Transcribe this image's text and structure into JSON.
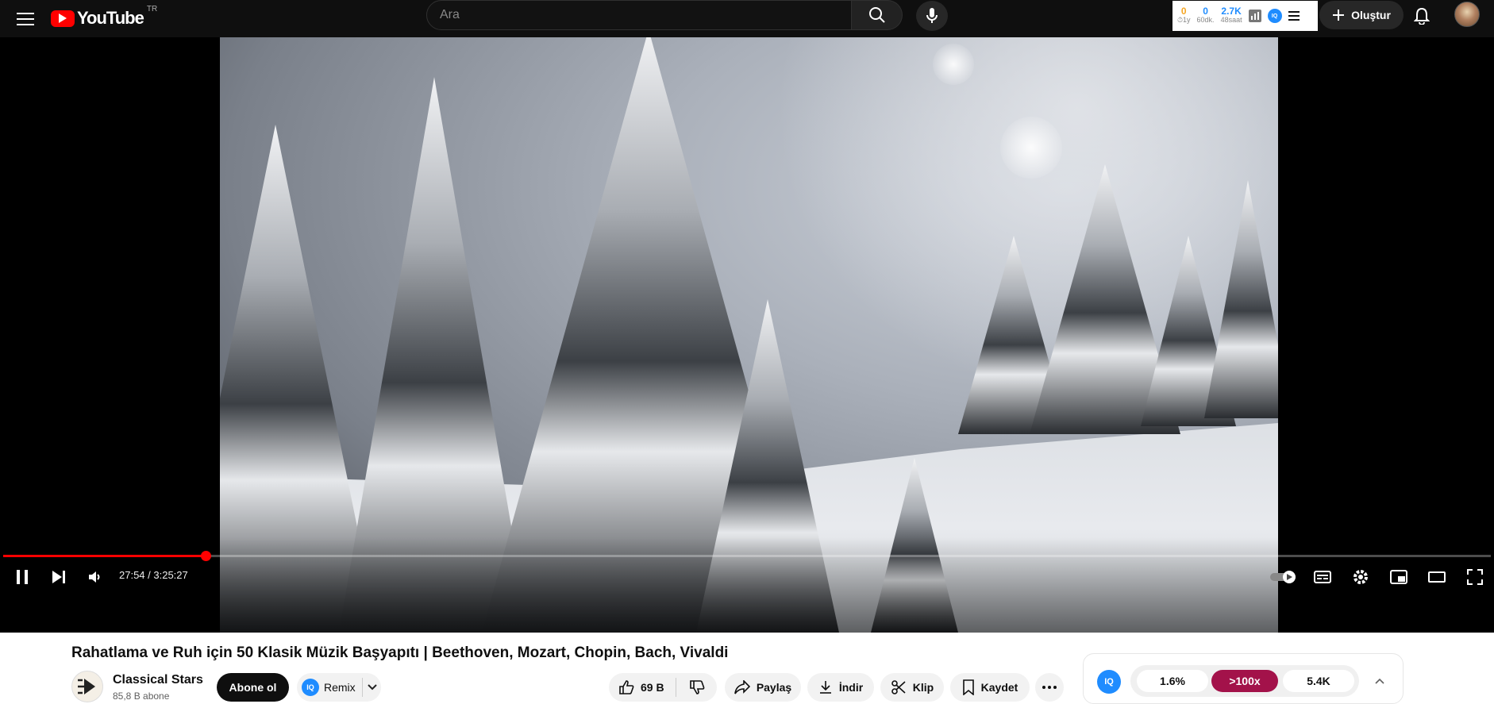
{
  "header": {
    "logo_text": "YouTube",
    "country": "TR",
    "search_placeholder": "Ara",
    "create_label": "Oluştur",
    "stats": [
      {
        "value": "0",
        "label": "⏱1y",
        "color": "#f5a623"
      },
      {
        "value": "0",
        "label": "60dk.",
        "color": "#1f8cff"
      },
      {
        "value": "2.7K",
        "label": "48saat",
        "color": "#1f8cff"
      }
    ],
    "iq_badge": "IQ"
  },
  "player": {
    "time": "27:54 / 3:25:27",
    "progress_fraction": 0.136,
    "accent": "#ff0000"
  },
  "video": {
    "title": "Rahatlama ve Ruh için 50 Klasik Müzik Başyapıtı | Beethoven, Mozart, Chopin, Bach, Vivaldi"
  },
  "channel": {
    "name": "Classical Stars",
    "subscribers": "85,8 B abone",
    "subscribe_label": "Abone ol",
    "remix_label": "Remix"
  },
  "actions": {
    "likes": "69 B",
    "share": "Paylaş",
    "download": "İndir",
    "clip": "Klip",
    "save": "Kaydet"
  },
  "iq_panel": {
    "logo": "IQ",
    "chips": [
      "1.6%",
      ">100x",
      "5.4K"
    ],
    "highlight_color": "#a3124a"
  }
}
